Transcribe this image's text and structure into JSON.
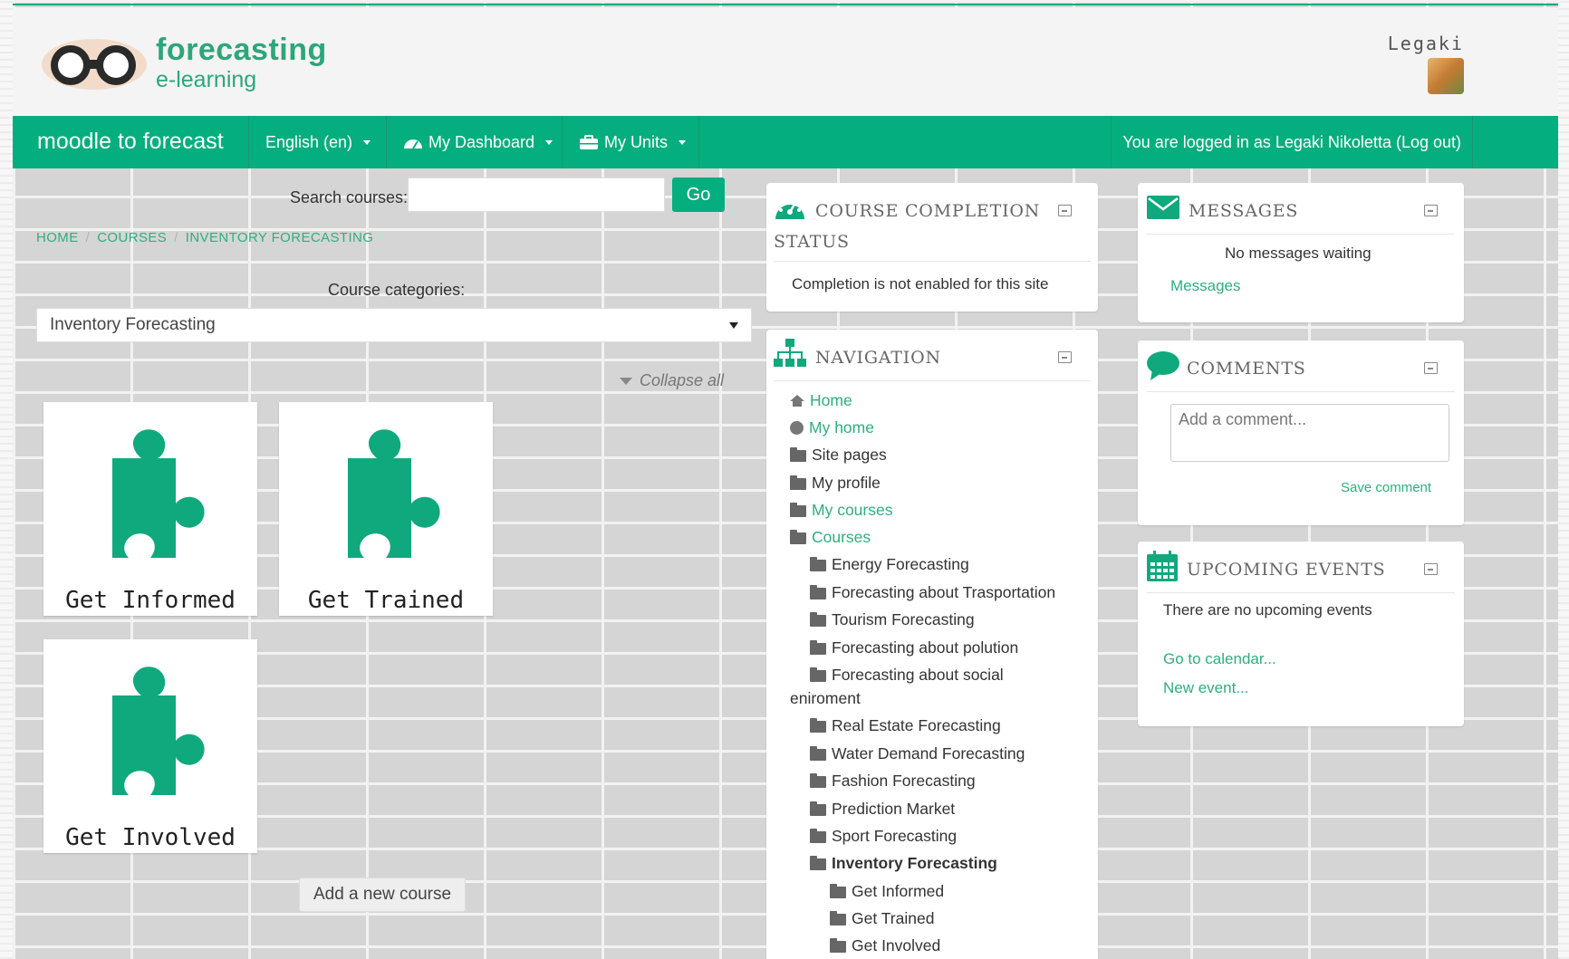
{
  "header": {
    "brand_line1": "forecasting",
    "brand_line2": "e-learning",
    "user_name": "Legaki"
  },
  "navbar": {
    "brand": "moodle to forecast",
    "language": "English (en)",
    "dashboard": "My Dashboard",
    "units": "My Units",
    "login_status": "You are logged in as Legaki Nikoletta (Log out)"
  },
  "search": {
    "label": "Search courses:",
    "value": "",
    "button": "Go"
  },
  "breadcrumb": [
    "HOME",
    "COURSES",
    "INVENTORY FORECASTING"
  ],
  "categories": {
    "label": "Course categories:",
    "selected": "Inventory Forecasting"
  },
  "collapse_all": "Collapse all",
  "tiles": [
    "Get Informed",
    "Get Trained",
    "Get Involved"
  ],
  "add_course": "Add a new course",
  "completion_block": {
    "title_line1": "COURSE COMPLETION",
    "title_line2": "STATUS",
    "text": "Completion is not enabled for this site"
  },
  "navigation_block": {
    "title": "NAVIGATION",
    "items": [
      {
        "label": "Home",
        "icon": "home-icon",
        "style": "link"
      },
      {
        "label": "My home",
        "icon": "dot-icon",
        "style": "link"
      },
      {
        "label": "Site pages",
        "icon": "folder-icon",
        "style": "text"
      },
      {
        "label": "My profile",
        "icon": "folder-icon",
        "style": "text"
      },
      {
        "label": "My courses",
        "icon": "folder-icon",
        "style": "link"
      },
      {
        "label": "Courses",
        "icon": "folder-icon",
        "style": "link"
      },
      {
        "label": "Energy Forecasting",
        "icon": "folder-icon",
        "style": "text"
      },
      {
        "label": "Forecasting about Trasportation",
        "icon": "folder-icon",
        "style": "text"
      },
      {
        "label": "Tourism Forecasting",
        "icon": "folder-icon",
        "style": "text"
      },
      {
        "label": "Forecasting about polution",
        "icon": "folder-icon",
        "style": "text"
      },
      {
        "label": "Forecasting about social",
        "icon": "folder-icon",
        "style": "text"
      },
      {
        "label": "eniroment",
        "icon": "",
        "style": "text"
      },
      {
        "label": "Real Estate Forecasting",
        "icon": "folder-icon",
        "style": "text"
      },
      {
        "label": "Water Demand Forecasting",
        "icon": "folder-icon",
        "style": "text"
      },
      {
        "label": "Fashion Forecasting",
        "icon": "folder-icon",
        "style": "text"
      },
      {
        "label": "Prediction Market",
        "icon": "folder-icon",
        "style": "text"
      },
      {
        "label": "Sport Forecasting",
        "icon": "folder-icon",
        "style": "text"
      },
      {
        "label": "Inventory Forecasting",
        "icon": "folder-icon",
        "style": "bold"
      },
      {
        "label": "Get Informed",
        "icon": "folder-icon",
        "style": "text"
      },
      {
        "label": "Get Trained",
        "icon": "folder-icon",
        "style": "text"
      },
      {
        "label": "Get Involved",
        "icon": "folder-icon",
        "style": "text"
      }
    ]
  },
  "messages_block": {
    "title": "MESSAGES",
    "text": "No messages waiting",
    "link": "Messages"
  },
  "comments_block": {
    "title": "COMMENTS",
    "placeholder": "Add a comment...",
    "save": "Save comment"
  },
  "events_block": {
    "title": "UPCOMING EVENTS",
    "text": "There are no upcoming events",
    "link_calendar": "Go to calendar...",
    "link_new": "New event..."
  },
  "colors": {
    "accent": "#04ae7e",
    "link": "#2fae7f"
  }
}
